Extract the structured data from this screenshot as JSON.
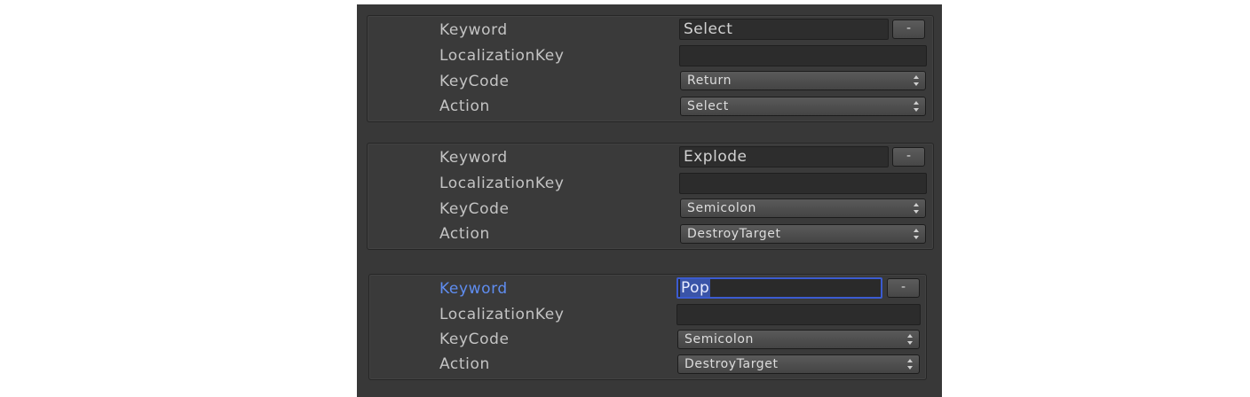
{
  "labels": {
    "keyword": "Keyword",
    "localization_key": "LocalizationKey",
    "keycode": "KeyCode",
    "action": "Action"
  },
  "minus_label": "-",
  "entries": [
    {
      "keyword": "Select",
      "localization_key": "",
      "keycode": "Return",
      "action": "Select",
      "focused": false
    },
    {
      "keyword": "Explode",
      "localization_key": "",
      "keycode": "Semicolon",
      "action": "DestroyTarget",
      "focused": false
    },
    {
      "keyword": "Pop",
      "localization_key": "",
      "keycode": "Semicolon",
      "action": "DestroyTarget",
      "focused": true
    }
  ],
  "colors": {
    "background": "#383838",
    "label": "#c4c4c4",
    "focus_label": "#5f8df0",
    "focus_border": "#3b5bd0",
    "selection": "#3a54a8"
  },
  "icons": {
    "dropdown_arrows": "updown-arrows-icon"
  }
}
